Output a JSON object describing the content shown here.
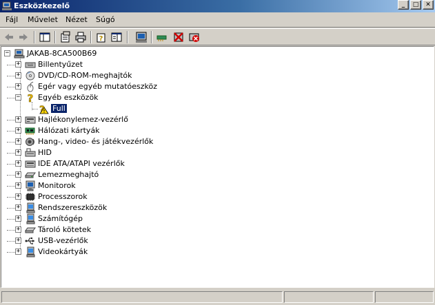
{
  "window": {
    "title": "Eszközkezelő"
  },
  "menu": {
    "items": [
      "Fájl",
      "Művelet",
      "Nézet",
      "Súgó"
    ]
  },
  "toolbar": {
    "buttons": [
      "back-icon",
      "forward-icon",
      "console-tree-icon",
      "properties-icon",
      "print-icon",
      "help-icon",
      "details-view-icon",
      "scan-hardware-icon",
      "update-driver-icon",
      "disable-device-icon",
      "uninstall-device-icon"
    ]
  },
  "tree": {
    "root": "JAKAB-8CA500B69",
    "nodes": [
      {
        "label": "Billentyűzet",
        "icon": "keyboard-icon",
        "expanded": false
      },
      {
        "label": "DVD/CD-ROM-meghajtók",
        "icon": "cdrom-icon",
        "expanded": false
      },
      {
        "label": "Egér vagy egyéb mutatóeszköz",
        "icon": "mouse-icon",
        "expanded": false
      },
      {
        "label": "Egyéb eszközök",
        "icon": "unknown-device-icon",
        "expanded": true,
        "children": [
          {
            "label": "Full",
            "icon": "warning-device-icon",
            "selected": true
          }
        ]
      },
      {
        "label": "Hajlékonylemez-vezérlő",
        "icon": "floppy-controller-icon",
        "expanded": false
      },
      {
        "label": "Hálózati kártyák",
        "icon": "network-card-icon",
        "expanded": false
      },
      {
        "label": "Hang-, video- és játékvezérlők",
        "icon": "sound-icon",
        "expanded": false
      },
      {
        "label": "HID",
        "icon": "hid-icon",
        "expanded": false
      },
      {
        "label": "IDE ATA/ATAPI vezérlők",
        "icon": "ide-controller-icon",
        "expanded": false
      },
      {
        "label": "Lemezmeghajtó",
        "icon": "disk-drive-icon",
        "expanded": false
      },
      {
        "label": "Monitorok",
        "icon": "monitor-icon",
        "expanded": false
      },
      {
        "label": "Processzorok",
        "icon": "processor-icon",
        "expanded": false
      },
      {
        "label": "Rendszereszközök",
        "icon": "system-device-icon",
        "expanded": false
      },
      {
        "label": "Számítógép",
        "icon": "computer-icon",
        "expanded": false
      },
      {
        "label": "Tároló kötetek",
        "icon": "storage-volume-icon",
        "expanded": false
      },
      {
        "label": "USB-vezérlők",
        "icon": "usb-icon",
        "expanded": false
      },
      {
        "label": "Videokártyák",
        "icon": "display-adapter-icon",
        "expanded": false
      }
    ]
  },
  "colors": {
    "selection": "#0a246a",
    "titlebar_start": "#0a246a",
    "titlebar_end": "#a6caf0",
    "face": "#d4d0c8"
  }
}
